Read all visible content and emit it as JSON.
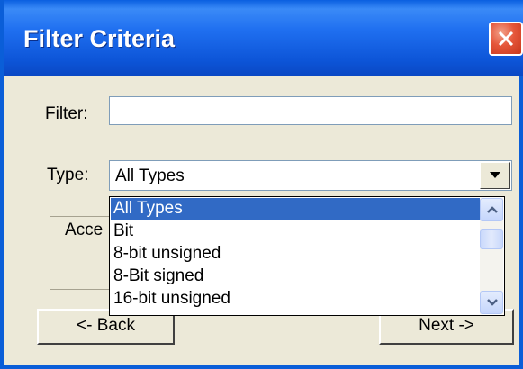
{
  "window": {
    "title": "Filter Criteria"
  },
  "filter": {
    "label": "Filter:",
    "value": ""
  },
  "type": {
    "label": "Type:",
    "selected": "All Types",
    "options": [
      "All Types",
      "Bit",
      "8-bit unsigned",
      "8-Bit signed",
      "16-bit unsigned"
    ],
    "highlighted_index": 0
  },
  "access_group": {
    "label": "Acce"
  },
  "buttons": {
    "back": "<- Back",
    "next": "Next ->"
  },
  "colors": {
    "title_bar": "#0a5ed8",
    "close_button": "#e5563a",
    "selection": "#316ac5",
    "dialog_bg": "#ece9d8"
  }
}
